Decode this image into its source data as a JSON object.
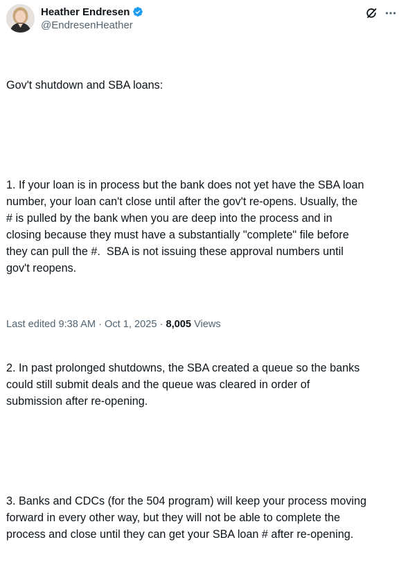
{
  "author": {
    "display_name": "Heather Endresen",
    "handle": "@EndresenHeather",
    "verified_icon": "verified-badge-icon",
    "verified_color": "#1d9bf0"
  },
  "header_actions": {
    "grok_icon": "grok-icon",
    "more_icon": "more-icon"
  },
  "tweet": {
    "paragraphs": [
      "Gov't shutdown and SBA loans:",
      "1. If your loan is in process but the bank does not yet have the SBA loan\nnumber, your loan can't close until after the gov't re-opens. Usually, the\n# is pulled by the bank when you are deep into the process and in\nclosing because they must have a substantially \"complete\" file before\nthey can pull the #.  SBA is not issuing these approval numbers until\ngov't reopens.",
      "2. In past prolonged shutdowns, the SBA created a queue so the banks\ncould still submit deals and the queue was cleared in order of\nsubmission after re-opening.",
      "3. Banks and CDCs (for the 504 program) will keep your process moving\nforward in every other way, but they will not be able to complete the\nprocess and close until they can get your SBA loan # after re-opening."
    ]
  },
  "meta": {
    "edited_label": "Last edited",
    "time": "9:38 AM",
    "separator": "·",
    "date": "Oct 1, 2025",
    "views_count": "8,005",
    "views_label": "Views"
  },
  "colors": {
    "text_primary": "#0f1419",
    "text_secondary": "#536471",
    "accent": "#1d9bf0"
  }
}
